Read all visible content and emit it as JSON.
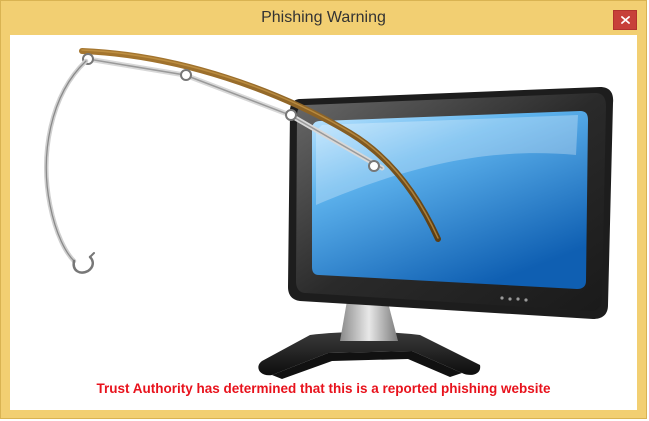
{
  "window": {
    "title": "Phishing Warning",
    "close_icon": "close-icon",
    "close_glyph": "x"
  },
  "content": {
    "illustration_icons": [
      "monitor-icon",
      "fishing-rod-icon",
      "hook-icon"
    ],
    "warning_message": "Trust Authority has determined that this is a reported phishing website"
  },
  "colors": {
    "titlebar": "#f2cf72",
    "close_button": "#c7403a",
    "warning_text": "#e8121c",
    "screen_blue": "#2d8fd6"
  }
}
